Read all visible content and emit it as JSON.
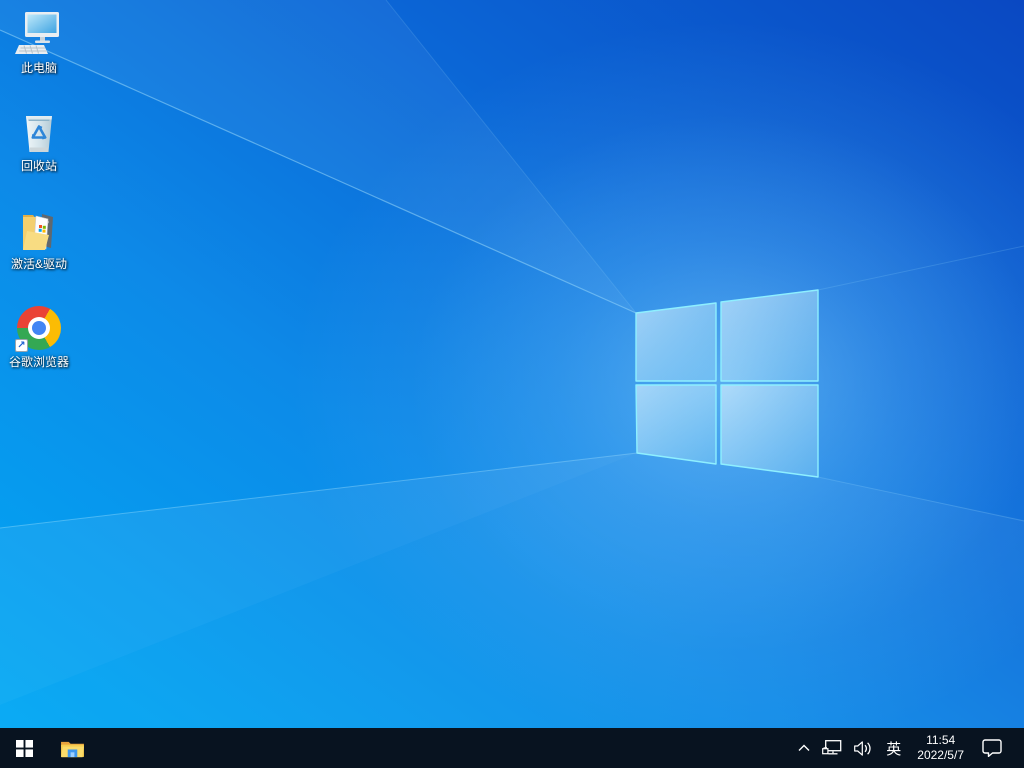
{
  "desktop": {
    "icons": [
      {
        "label": "此电脑",
        "icon": "this-pc-icon"
      },
      {
        "label": "回收站",
        "icon": "recycle-bin-icon"
      },
      {
        "label": "激活&驱动",
        "icon": "open-folder-icon"
      },
      {
        "label": "谷歌浏览器",
        "icon": "chrome-icon"
      }
    ],
    "shortcut_arrow_glyph": "↗"
  },
  "taskbar": {
    "ime_indicator": "英",
    "clock": {
      "time": "11:54",
      "date": "2022/5/7"
    }
  },
  "colors": {
    "taskbar_bg": "#081320",
    "wallpaper_light_blue": "#00a8f4",
    "wallpaper_dark_blue": "#0a48c2",
    "logo_edge_cyan": "#8eefff",
    "tray_glyph": "#ffffff"
  }
}
